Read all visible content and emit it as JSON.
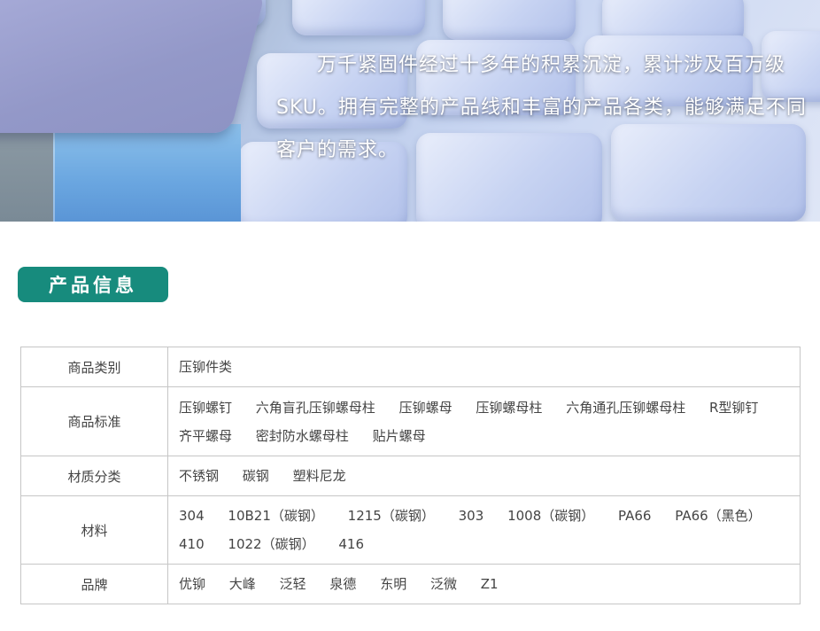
{
  "banner": {
    "text": "万千紧固件经过十多年的积累沉淀，累计涉及百万级SKU。拥有完整的产品线和丰富的产品各类，能够满足不同客户的需求。"
  },
  "section": {
    "title": "产品信息"
  },
  "info_table": {
    "rows": [
      {
        "label": "商品类别",
        "values": [
          "压铆件类"
        ]
      },
      {
        "label": "商品标准",
        "values": [
          "压铆螺钉",
          "六角盲孔压铆螺母柱",
          "压铆螺母",
          "压铆螺母柱",
          "六角通孔压铆螺母柱",
          "R型铆钉",
          "齐平螺母",
          "密封防水螺母柱",
          "贴片螺母"
        ]
      },
      {
        "label": "材质分类",
        "values": [
          "不锈钢",
          "碳钢",
          "塑料尼龙"
        ]
      },
      {
        "label": "材料",
        "values": [
          "304",
          "10B21（碳钢）",
          "1215（碳钢）",
          "303",
          "1008（碳钢）",
          "PA66",
          "PA66（黑色）",
          "410",
          "1022（碳钢）",
          "416"
        ]
      },
      {
        "label": "品牌",
        "values": [
          "优铆",
          "大峰",
          "泛轻",
          "泉德",
          "东明",
          "泛微",
          "Z1"
        ]
      }
    ]
  },
  "colors": {
    "accent": "#178b7d",
    "table_border": "#c6c6c6"
  }
}
